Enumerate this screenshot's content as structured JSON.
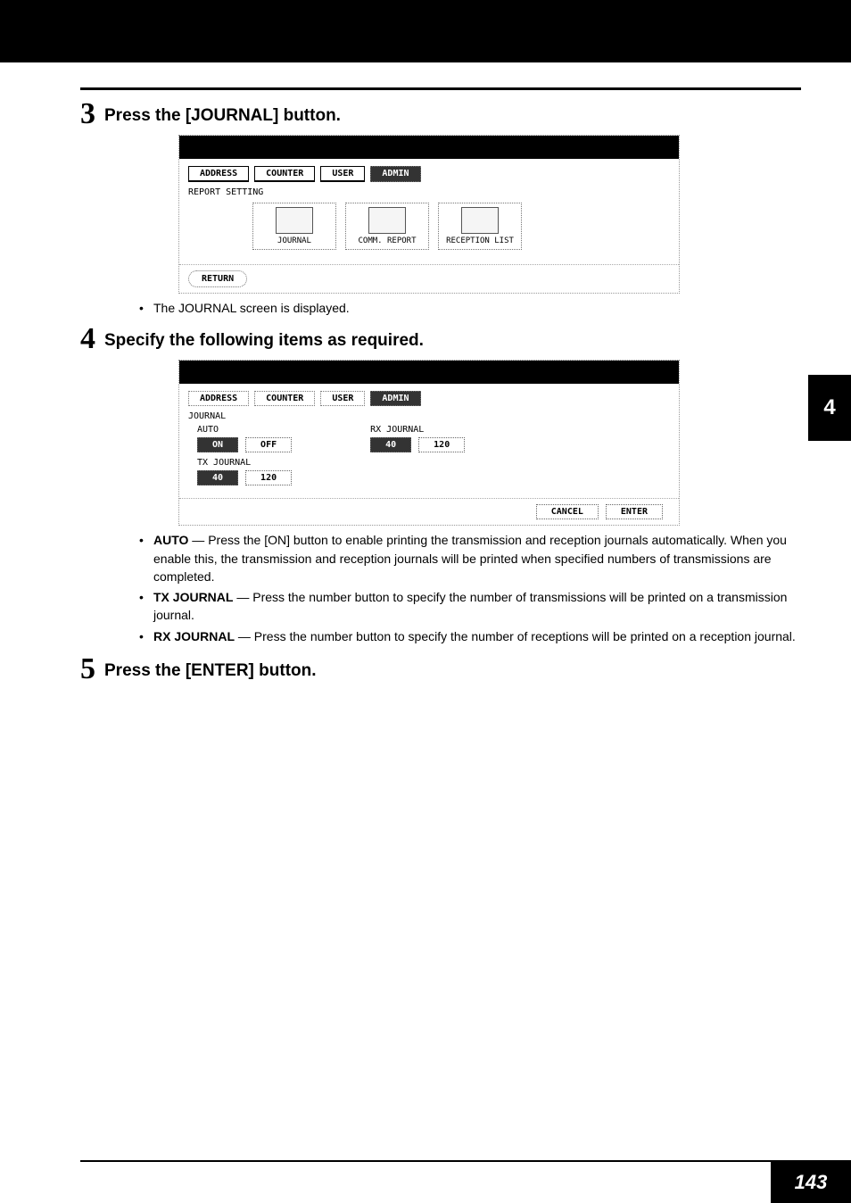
{
  "steps": {
    "s3": {
      "num": "3",
      "title": "Press the [JOURNAL] button."
    },
    "s4": {
      "num": "4",
      "title": "Specify the following items as required."
    },
    "s5": {
      "num": "5",
      "title": "Press the [ENTER] button."
    }
  },
  "note3": "The JOURNAL screen is displayed.",
  "tabs": {
    "address": "ADDRESS",
    "counter": "COUNTER",
    "user": "USER",
    "admin": "ADMIN"
  },
  "shot1": {
    "subtitle": "REPORT SETTING",
    "icons": {
      "journal": "JOURNAL",
      "comm_report": "COMM. REPORT",
      "reception_list": "RECEPTION LIST"
    },
    "return": "RETURN"
  },
  "shot2": {
    "subtitle": "JOURNAL",
    "auto_label": "AUTO",
    "on": "ON",
    "off": "OFF",
    "txj": "TX JOURNAL",
    "rxj": "RX JOURNAL",
    "v40": "40",
    "v120": "120",
    "cancel": "CANCEL",
    "enter": "ENTER"
  },
  "explain": {
    "auto_head": "AUTO",
    "auto_body": " — Press the [ON] button to enable printing the transmission and reception journals automatically. When you enable this, the transmission and reception journals will be printed when specified numbers of transmissions are completed.",
    "tx_head": "TX JOURNAL",
    "tx_body": " — Press the number button to specify the number of transmissions will be printed on a transmission journal.",
    "rx_head": "RX JOURNAL",
    "rx_body": " — Press the number button to specify the number of receptions will be printed on a reception journal."
  },
  "side_tab": "4",
  "page_num": "143"
}
